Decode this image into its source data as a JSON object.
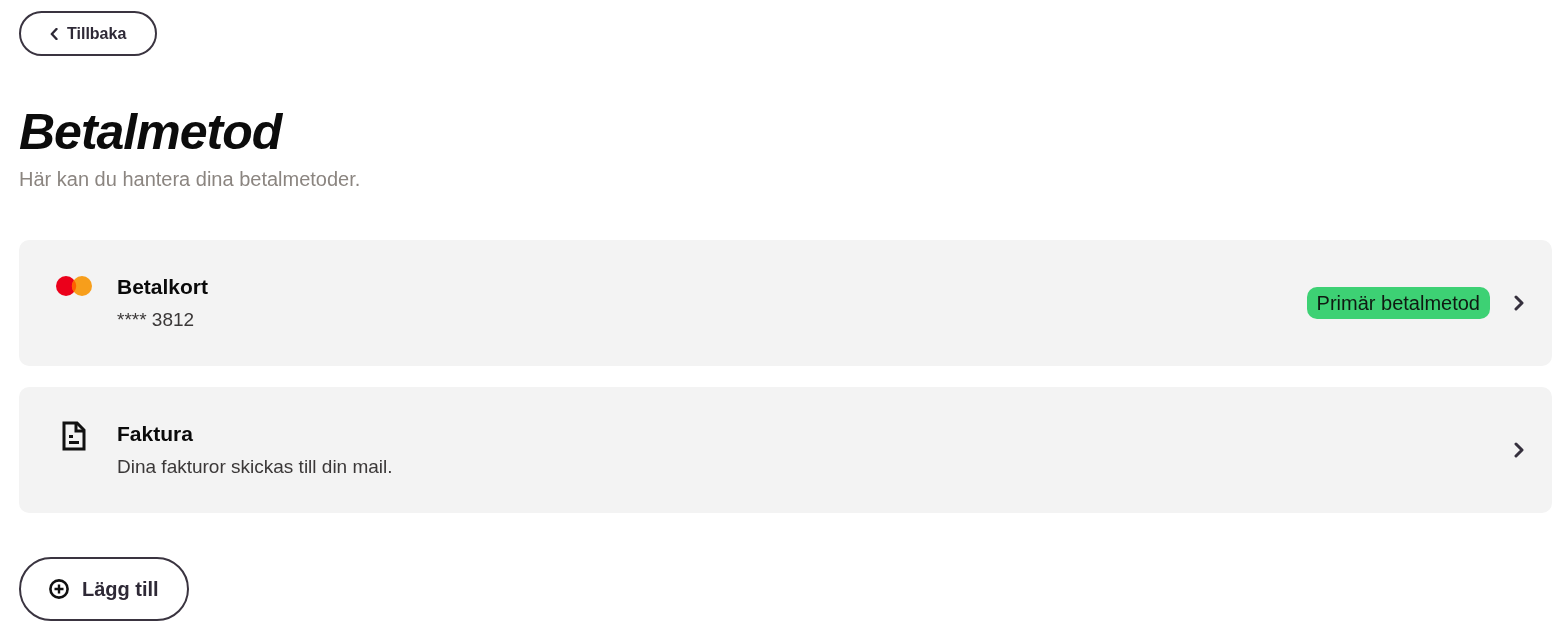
{
  "back_button": {
    "label": "Tillbaka"
  },
  "title": "Betalmetod",
  "subtitle": "Här kan du hantera dina betalmetoder.",
  "methods": [
    {
      "kind": "card",
      "title": "Betalkort",
      "detail": "**** 3812",
      "badge": "Primär betalmetod"
    },
    {
      "kind": "invoice",
      "title": "Faktura",
      "detail": "Dina fakturor skickas till din mail."
    }
  ],
  "add_button": {
    "label": "Lägg till"
  }
}
